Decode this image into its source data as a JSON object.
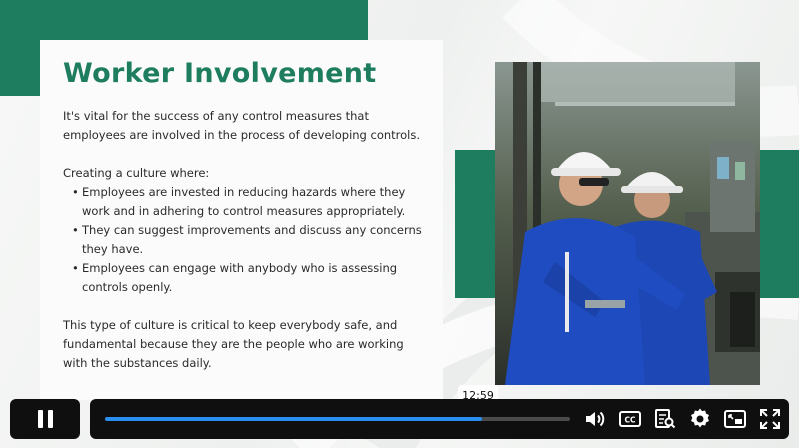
{
  "slide": {
    "title": "Worker Involvement",
    "intro": "It's vital for the success of any control measures that employees are involved in the process of developing controls.",
    "culture_heading": "Creating a culture where:",
    "bullets": [
      "Employees are invested in reducing hazards where they work and in adhering to control measures appropriately.",
      "They can suggest improvements and discuss any concerns they have.",
      "Employees can engage with anybody who is assessing controls openly."
    ],
    "closing": "This type of culture is critical to keep everybody safe, and fundamental because they are the people who are working with the substances daily."
  },
  "player": {
    "time_tooltip": "12:59",
    "progress": 0.81,
    "icons": [
      "pause-icon",
      "volume-icon",
      "captions-icon",
      "transcript-icon",
      "settings-icon",
      "picture-in-picture-icon",
      "fullscreen-icon"
    ]
  },
  "colors": {
    "brand_green": "#1e7d5f",
    "progress_blue": "#2a8df0",
    "control_bar": "#0f0f0f"
  }
}
